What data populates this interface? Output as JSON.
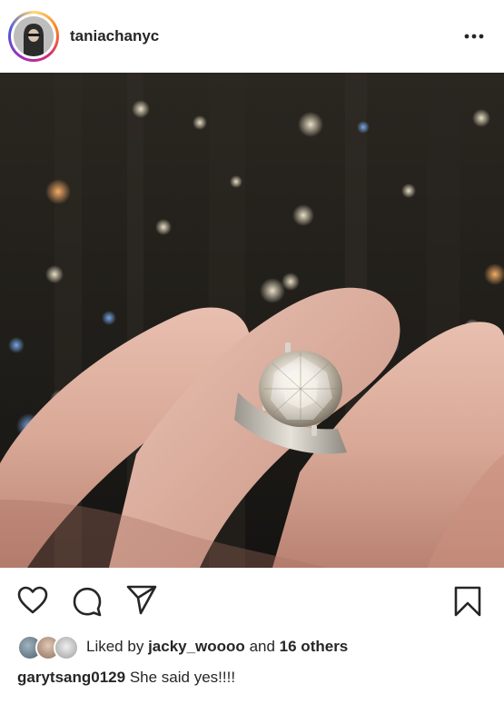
{
  "post": {
    "username": "taniachanyc",
    "more_icon": "more-horizontal-icon"
  },
  "actions": {
    "like_icon": "heart-icon",
    "comment_icon": "comment-icon",
    "share_icon": "paper-plane-icon",
    "save_icon": "bookmark-icon"
  },
  "likes": {
    "prefix": "Liked by",
    "liker": "jacky_woooo",
    "conjunction": "and",
    "others": "16 others"
  },
  "caption": {
    "author": "garytsang0129",
    "text": "She said yes!!!!"
  }
}
